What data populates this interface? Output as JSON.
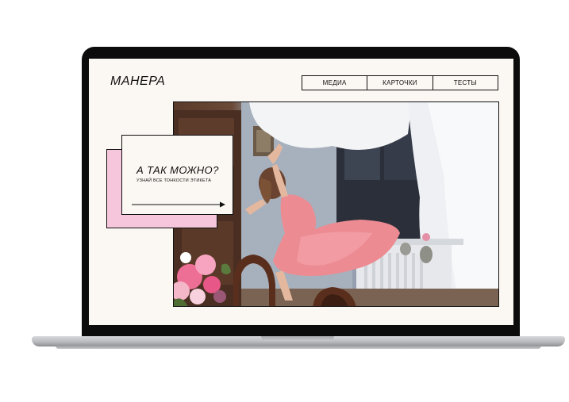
{
  "site": {
    "logo": "МАНЕРА",
    "nav": [
      {
        "label": "МЕДИА"
      },
      {
        "label": "КАРТОЧКИ"
      },
      {
        "label": "ТЕСТЫ"
      }
    ]
  },
  "hero": {
    "title": "А ТАК МОЖНО?",
    "subtitle": "УЗНАЙ ВСЕ ТОНКОСТИ ЭТИКЕТА",
    "cta_icon": "arrow-right-icon"
  },
  "colors": {
    "background": "#fbf7f2",
    "accent_pink": "#f6c7dc",
    "frame": "#0c0c0c",
    "text": "#111111"
  }
}
